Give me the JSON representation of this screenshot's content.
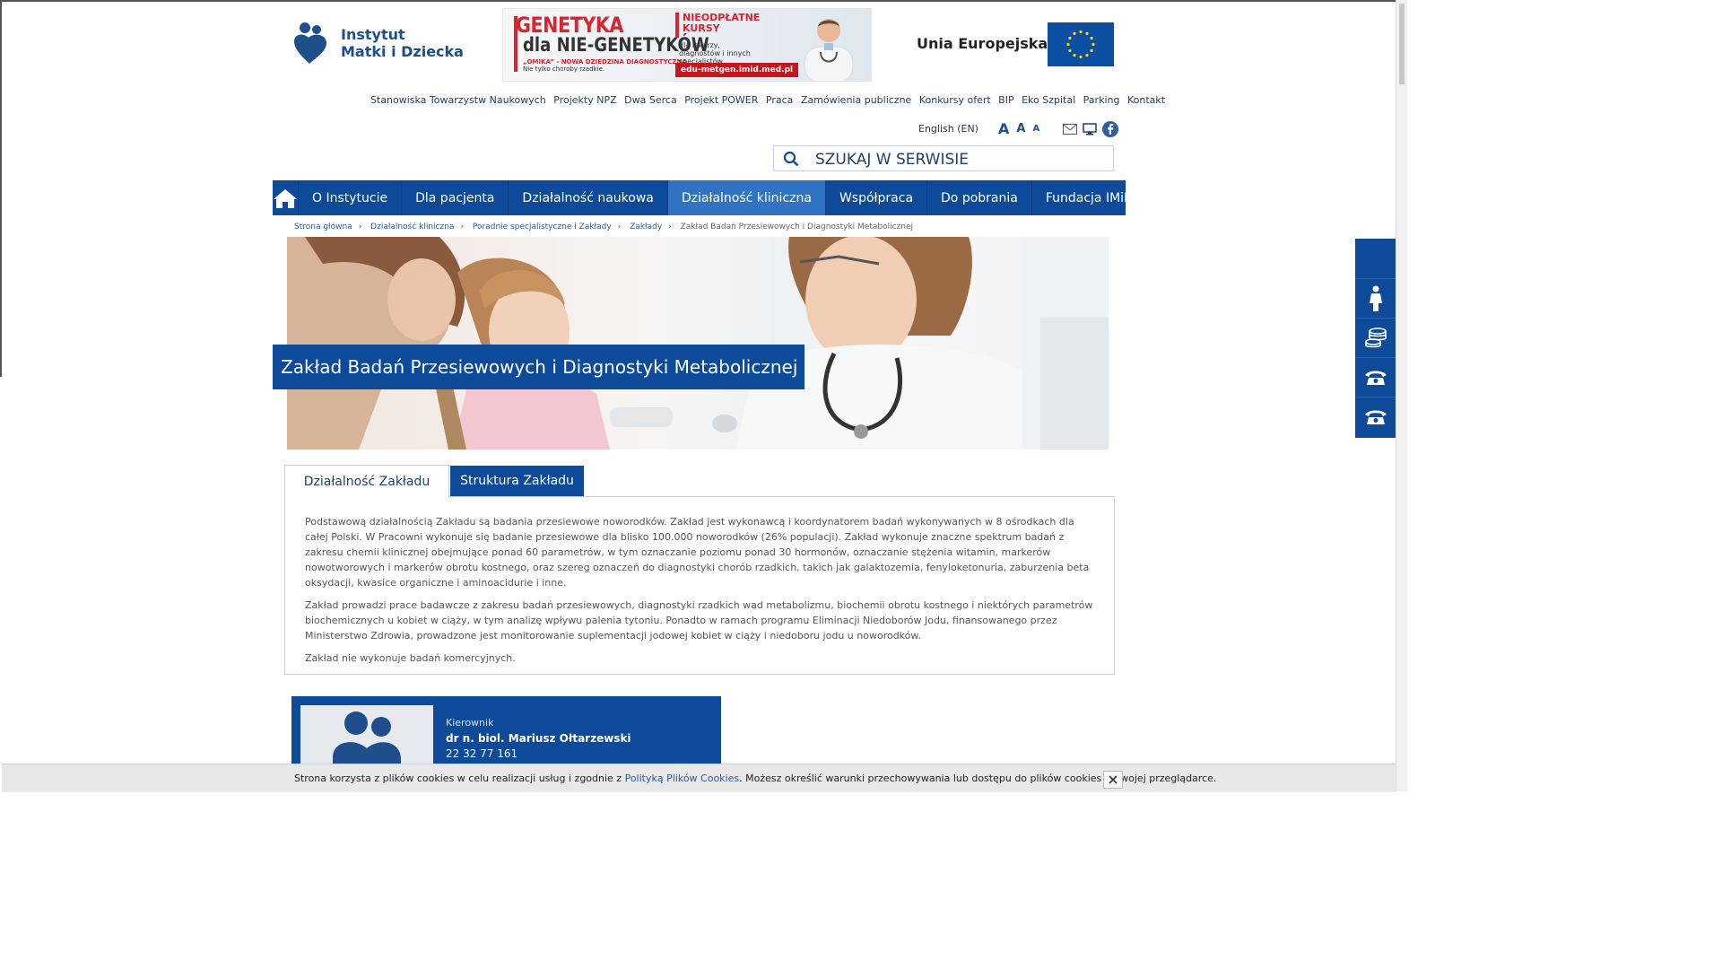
{
  "logo": {
    "line1": "Instytut",
    "line2": "Matki i Dziecka"
  },
  "banner": {
    "title1": "GENETYKA",
    "title2": "dla NIE-GENETYKÓW",
    "sub1": "„OMIKA” - NOWA DZIEDZINA DIAGNOSTYCZNA",
    "sub2": "Nie tylko choroby rzadkie.",
    "box_title": "NIEODPŁATNE KURSY",
    "box_text": "dla lekarzy, diagnostów i innych specjalistów",
    "url": "edu-metgen.imid.med.pl"
  },
  "eu": {
    "label": "Unia Europejska"
  },
  "topnav": [
    "Stanowiska Towarzystw Naukowych",
    "Projekty NPZ",
    "Dwa Serca",
    "Projekt POWER",
    "Praca",
    "Zamówienia publiczne",
    "Konkursy ofert",
    "BIP",
    "Eko Szpital",
    "Parking",
    "Kontakt"
  ],
  "utility": {
    "language": "English (EN)",
    "font_large": "A",
    "font_medium": "A",
    "font_small": "A"
  },
  "search": {
    "placeholder": "SZUKAJ W SERWISIE"
  },
  "mainnav": {
    "items": [
      "O Instytucie",
      "Dla pacjenta",
      "Działalność naukowa",
      "Działalność kliniczna",
      "Współpraca",
      "Do pobrania",
      "Fundacja IMiD"
    ],
    "active_index": 3
  },
  "breadcrumb": [
    "Strona główna",
    "Działalność kliniczna",
    "Poradnie specjalistyczne i Zakłady",
    "Zakłady",
    "Zakład Badań Przesiewowych i Diagnostyki Metabolicznej"
  ],
  "hero": {
    "title": "Zakład Badań Przesiewowych i Diagnostyki Metabolicznej"
  },
  "tabs": [
    "Działalność Zakładu",
    "Struktura Zakładu"
  ],
  "content": {
    "p1": "Podstawową działalnością Zakładu są badania przesiewowe noworodków. Zakład jest wykonawcą i koordynatorem badań wykonywanych w 8 ośrodkach dla całej Polski. W Pracowni wykonuje się badanie przesiewowe dla blisko 100.000 noworodków (26% populacji). Zakład wykonuje znaczne spektrum badań z zakresu chemii klinicznej obejmujące ponad 60 parametrów, w tym oznaczanie poziomu ponad 30 hormonów, oznaczanie stężenia witamin, markerów nowotworowych i markerów obrotu kostnego, oraz szereg oznaczeń do diagnostyki chorób rzadkich, takich jak galaktozemia, fenyloketonuria, zaburzenia beta oksydacji, kwasice organiczne i aminoacidurie i inne.",
    "p2": "Zakład prowadzi prace badawcze z zakresu badań przesiewowych, diagnostyki rzadkich wad metabolizmu, biochemii obrotu kostnego i niektórych parametrów biochemicznych u kobiet w ciąży, w tym analizę wpływu palenia tytoniu. Ponadto w ramach programu Eliminacji Niedoborów Jodu, finansowanego przez Ministerstwo Zdrowia, prowadzone jest monitorowanie suplementacji jodowej kobiet w ciąży i niedoboru jodu u noworodków.",
    "p3": "Zakład nie wykonuje badań komercyjnych."
  },
  "manager": {
    "role": "Kierownik",
    "name": "dr n. biol. Mariusz Ołtarzewski",
    "phone": "22 32 77 161"
  },
  "cookie": {
    "text_before": "Strona korzysta z plików cookies w celu realizacji usług i zgodnie z ",
    "link": "Polityką Plików Cookies",
    "text_after": ". Możesz określić warunki przechowywania lub dostępu do plików cookies w Twojej przeglądarce."
  },
  "colors": {
    "brand_blue": "#0d4a9a",
    "active_nav": "#3073c2",
    "banner_red": "#d9232e"
  }
}
